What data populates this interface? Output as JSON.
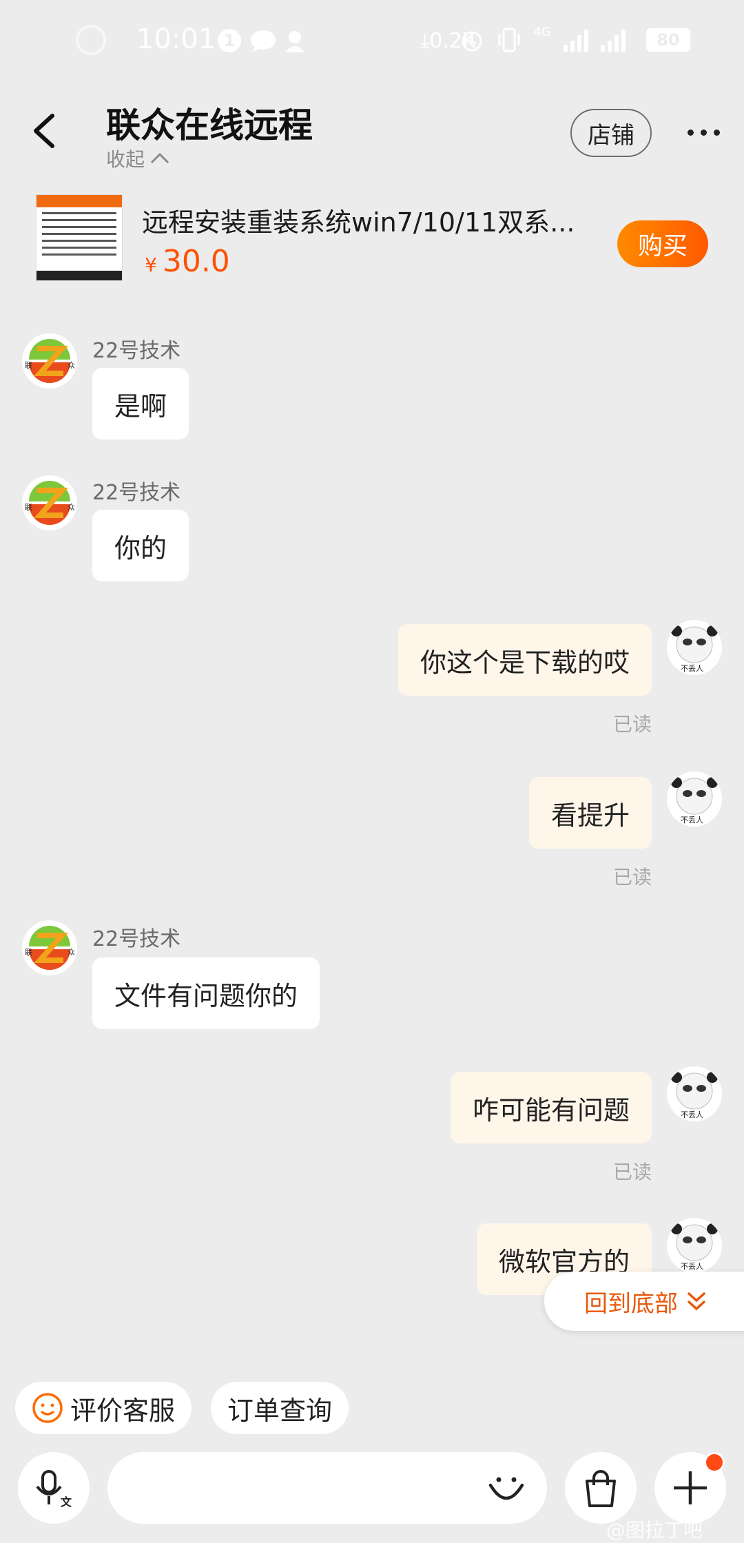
{
  "status_bar": {
    "time": "10:01",
    "notification_count": "1",
    "net_speed": "0.2K",
    "network_type": "4G",
    "battery": "80"
  },
  "header": {
    "title": "联众在线远程",
    "collapse_label": "收起",
    "shop_label": "店铺"
  },
  "product": {
    "title": "远程安装重装系统win7/10/11双系...",
    "currency": "¥",
    "price": "30.0",
    "buy_label": "购买"
  },
  "messages": [
    {
      "side": "in",
      "sender": "22号技术",
      "text": "是啊"
    },
    {
      "side": "in",
      "sender": "22号技术",
      "text": "你的"
    },
    {
      "side": "out",
      "text": "你这个是下载的哎",
      "status": "已读"
    },
    {
      "side": "out",
      "text": "看提升",
      "status": "已读"
    },
    {
      "side": "in",
      "sender": "22号技术",
      "text": "文件有问题你的"
    },
    {
      "side": "out",
      "text": "咋可能有问题",
      "status": "已读"
    },
    {
      "side": "out",
      "text": "微软官方的"
    }
  ],
  "avatars": {
    "right_caption": "不丢人",
    "left_left_char": "联",
    "left_right_char": "众"
  },
  "back_to_bottom_label": "回到底部",
  "quick_actions": [
    {
      "label": "评价客服",
      "icon": "smiley-icon"
    },
    {
      "label": "订单查询"
    }
  ],
  "input_bar": {
    "voice_icon": "mic-translate-icon",
    "emoji_icon": "emoji-icon",
    "bag_icon": "shopping-bag-icon",
    "plus_icon": "plus-icon"
  },
  "watermark": "@图拉丁吧",
  "colors": {
    "accent": "#ff5000",
    "buy_button": "#ff6a00",
    "outgoing_bubble": "#fff6ea",
    "background": "#ececec"
  }
}
